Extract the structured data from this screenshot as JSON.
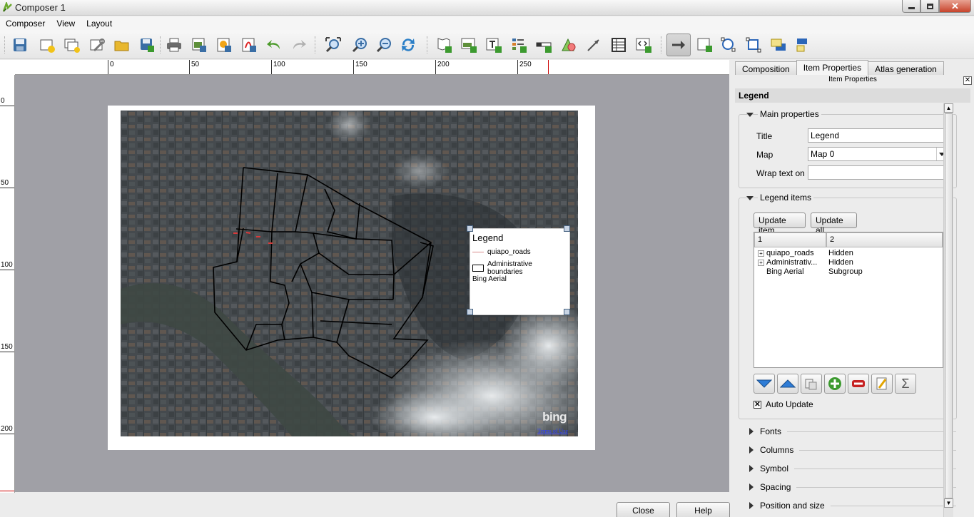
{
  "window": {
    "title": "Composer 1"
  },
  "menu": [
    "Composer",
    "View",
    "Layout"
  ],
  "toolbar": {
    "icons": [
      "save-icon",
      "new-composer-icon",
      "duplicate-composer-icon",
      "composer-manager-icon",
      "open-template-icon",
      "save-template-icon",
      "print-icon",
      "export-image-icon",
      "export-svg-icon",
      "export-pdf-icon",
      "undo-icon",
      "redo-icon",
      "zoom-full-icon",
      "zoom-in-icon",
      "zoom-out-icon",
      "refresh-icon",
      "add-map-icon",
      "add-image-icon",
      "add-label-icon",
      "add-legend-icon",
      "add-scalebar-icon",
      "add-shape-icon",
      "add-arrow-icon",
      "add-table-icon",
      "add-html-icon",
      "select-move-icon",
      "move-content-icon",
      "group-icon",
      "ungroup-icon",
      "raise-items-icon",
      "align-items-icon"
    ],
    "active": "select-move-icon"
  },
  "ruler": {
    "h_labels": [
      "0",
      "50",
      "100",
      "150",
      "200",
      "250"
    ],
    "v_labels": [
      "0",
      "50",
      "100",
      "150",
      "200"
    ]
  },
  "map_legend": {
    "title": "Legend",
    "items": [
      "quiapo_roads",
      "Administrative boundaries",
      "Bing Aerial"
    ]
  },
  "map_attribution": {
    "logo": "bing",
    "terms": "Terms of Use"
  },
  "bottom": {
    "close": "Close",
    "help": "Help"
  },
  "panel": {
    "tabs": [
      "Composition",
      "Item Properties",
      "Atlas generation"
    ],
    "active_tab": "Item Properties",
    "dock_title": "Item Properties",
    "section": "Legend",
    "main_properties": {
      "header": "Main properties",
      "title_label": "Title",
      "title_value": "Legend",
      "map_label": "Map",
      "map_value": "Map 0",
      "wrap_label": "Wrap text on",
      "wrap_value": ""
    },
    "legend_items": {
      "header": "Legend items",
      "update_item": "Update item",
      "update_all": "Update all",
      "columns": [
        "1",
        "2"
      ],
      "rows": [
        {
          "name": "quiapo_roads",
          "value": "Hidden",
          "expandable": true
        },
        {
          "name": "Administrativ...",
          "value": "Hidden",
          "expandable": true
        },
        {
          "name": "Bing Aerial",
          "value": "Subgroup",
          "expandable": false
        }
      ],
      "auto_update": "Auto Update"
    },
    "collapsed_sections": [
      "Fonts",
      "Columns",
      "Symbol",
      "Spacing",
      "Position and size"
    ]
  }
}
